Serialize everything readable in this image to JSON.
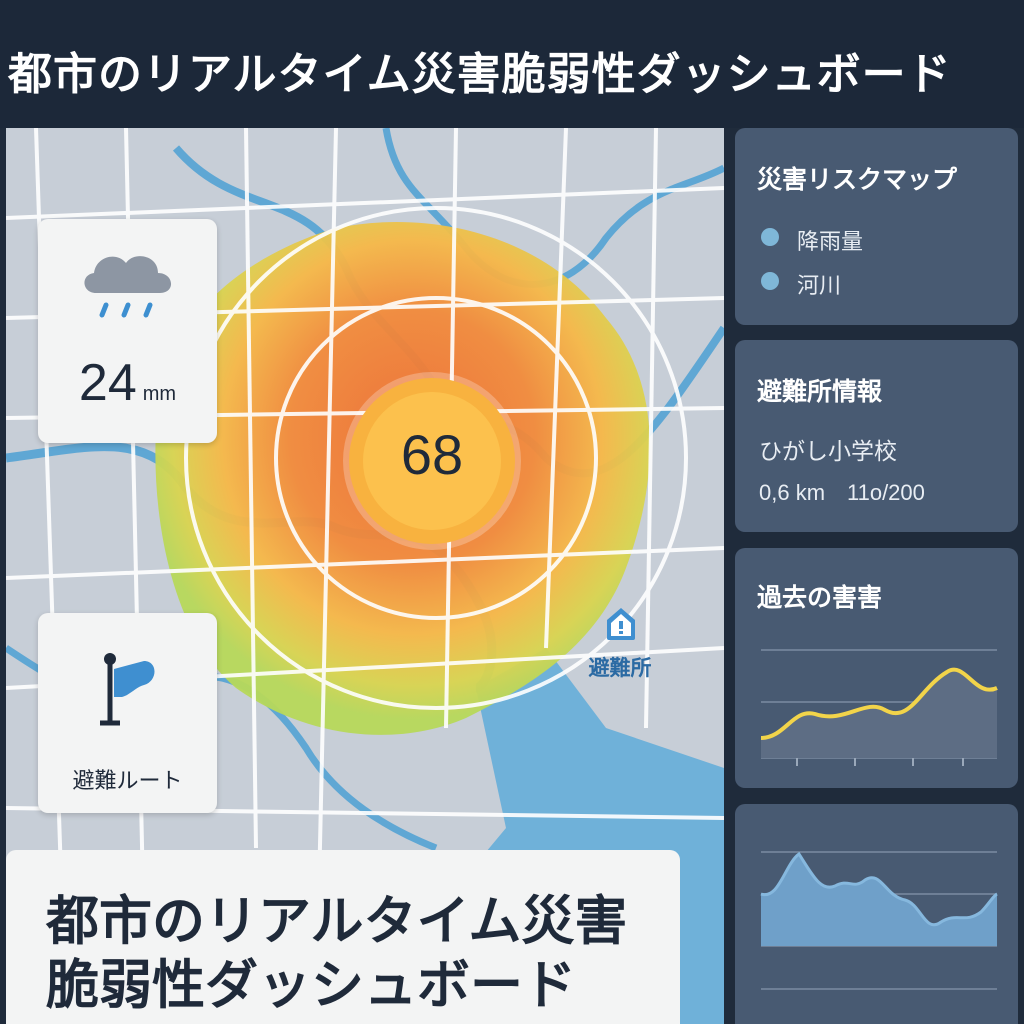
{
  "header": {
    "title": "都市のリアルタイム災害脆弱性ダッシュボード"
  },
  "map": {
    "rainfall": {
      "value": "24",
      "unit": "mm",
      "icon": "rain-cloud-icon"
    },
    "route": {
      "label": "避難ルート",
      "icon": "flag-icon"
    },
    "vulnerability_score": "68",
    "shelter_marker": {
      "label": "避難所",
      "icon": "house-alert-icon"
    },
    "colors": {
      "high": "#f07a35",
      "mid": "#f6b847",
      "low": "#b7d85a",
      "water": "#6fb1d9"
    }
  },
  "bottom_title": {
    "line1": "都市のリアルタイム災害",
    "line2": "脆弱性ダッシュボード"
  },
  "sidebar": {
    "risk_map": {
      "title": "災害リスクマップ",
      "legend": [
        {
          "label": "降雨量"
        },
        {
          "label": "河川"
        }
      ]
    },
    "shelter_info": {
      "title": "避難所情報",
      "name": "ひがし小学校",
      "distance": "0,6 km",
      "capacity": "11o/200"
    },
    "past_disasters": {
      "title": "過去の害害",
      "line_color": "#f2d44a"
    },
    "trend": {}
  }
}
